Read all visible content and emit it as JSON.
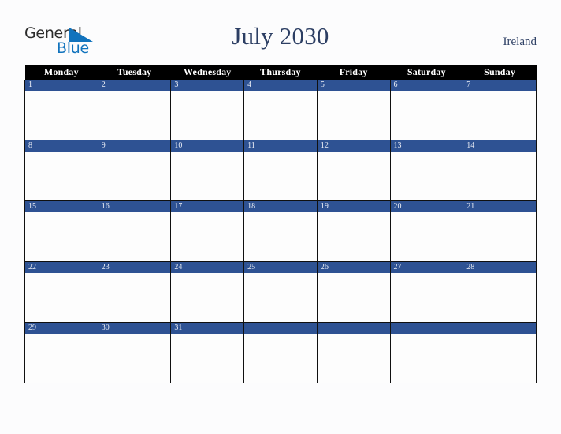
{
  "brand": {
    "name_part1": "General",
    "name_part2": "Blue",
    "triangle_color": "#1173bd",
    "text_color_primary": "#2b2b2b",
    "text_color_secondary": "#1173bd"
  },
  "header": {
    "title": "July 2030",
    "country": "Ireland",
    "title_color": "#2c3e63"
  },
  "calendar": {
    "month": "July",
    "year": "2030",
    "weekday_headers": [
      "Monday",
      "Tuesday",
      "Wednesday",
      "Thursday",
      "Friday",
      "Saturday",
      "Sunday"
    ],
    "header_bg": "#000000",
    "header_text": "#ffffff",
    "daynum_bg": "#2e5293",
    "daynum_text": "#e9ecf4",
    "cell_bg": "#fdfdfd",
    "border_color": "#101010",
    "weeks": [
      {
        "days": [
          {
            "num": "1",
            "blank": false
          },
          {
            "num": "2",
            "blank": false
          },
          {
            "num": "3",
            "blank": false
          },
          {
            "num": "4",
            "blank": false
          },
          {
            "num": "5",
            "blank": false
          },
          {
            "num": "6",
            "blank": false
          },
          {
            "num": "7",
            "blank": false
          }
        ]
      },
      {
        "days": [
          {
            "num": "8",
            "blank": false
          },
          {
            "num": "9",
            "blank": false
          },
          {
            "num": "10",
            "blank": false
          },
          {
            "num": "11",
            "blank": false
          },
          {
            "num": "12",
            "blank": false
          },
          {
            "num": "13",
            "blank": false
          },
          {
            "num": "14",
            "blank": false
          }
        ]
      },
      {
        "days": [
          {
            "num": "15",
            "blank": false
          },
          {
            "num": "16",
            "blank": false
          },
          {
            "num": "17",
            "blank": false
          },
          {
            "num": "18",
            "blank": false
          },
          {
            "num": "19",
            "blank": false
          },
          {
            "num": "20",
            "blank": false
          },
          {
            "num": "21",
            "blank": false
          }
        ]
      },
      {
        "days": [
          {
            "num": "22",
            "blank": false
          },
          {
            "num": "23",
            "blank": false
          },
          {
            "num": "24",
            "blank": false
          },
          {
            "num": "25",
            "blank": false
          },
          {
            "num": "26",
            "blank": false
          },
          {
            "num": "27",
            "blank": false
          },
          {
            "num": "28",
            "blank": false
          }
        ]
      },
      {
        "days": [
          {
            "num": "29",
            "blank": false
          },
          {
            "num": "30",
            "blank": false
          },
          {
            "num": "31",
            "blank": false
          },
          {
            "num": "",
            "blank": true
          },
          {
            "num": "",
            "blank": true
          },
          {
            "num": "",
            "blank": true
          },
          {
            "num": "",
            "blank": true
          }
        ]
      }
    ]
  },
  "page": {
    "background": "#fcfcfd"
  }
}
